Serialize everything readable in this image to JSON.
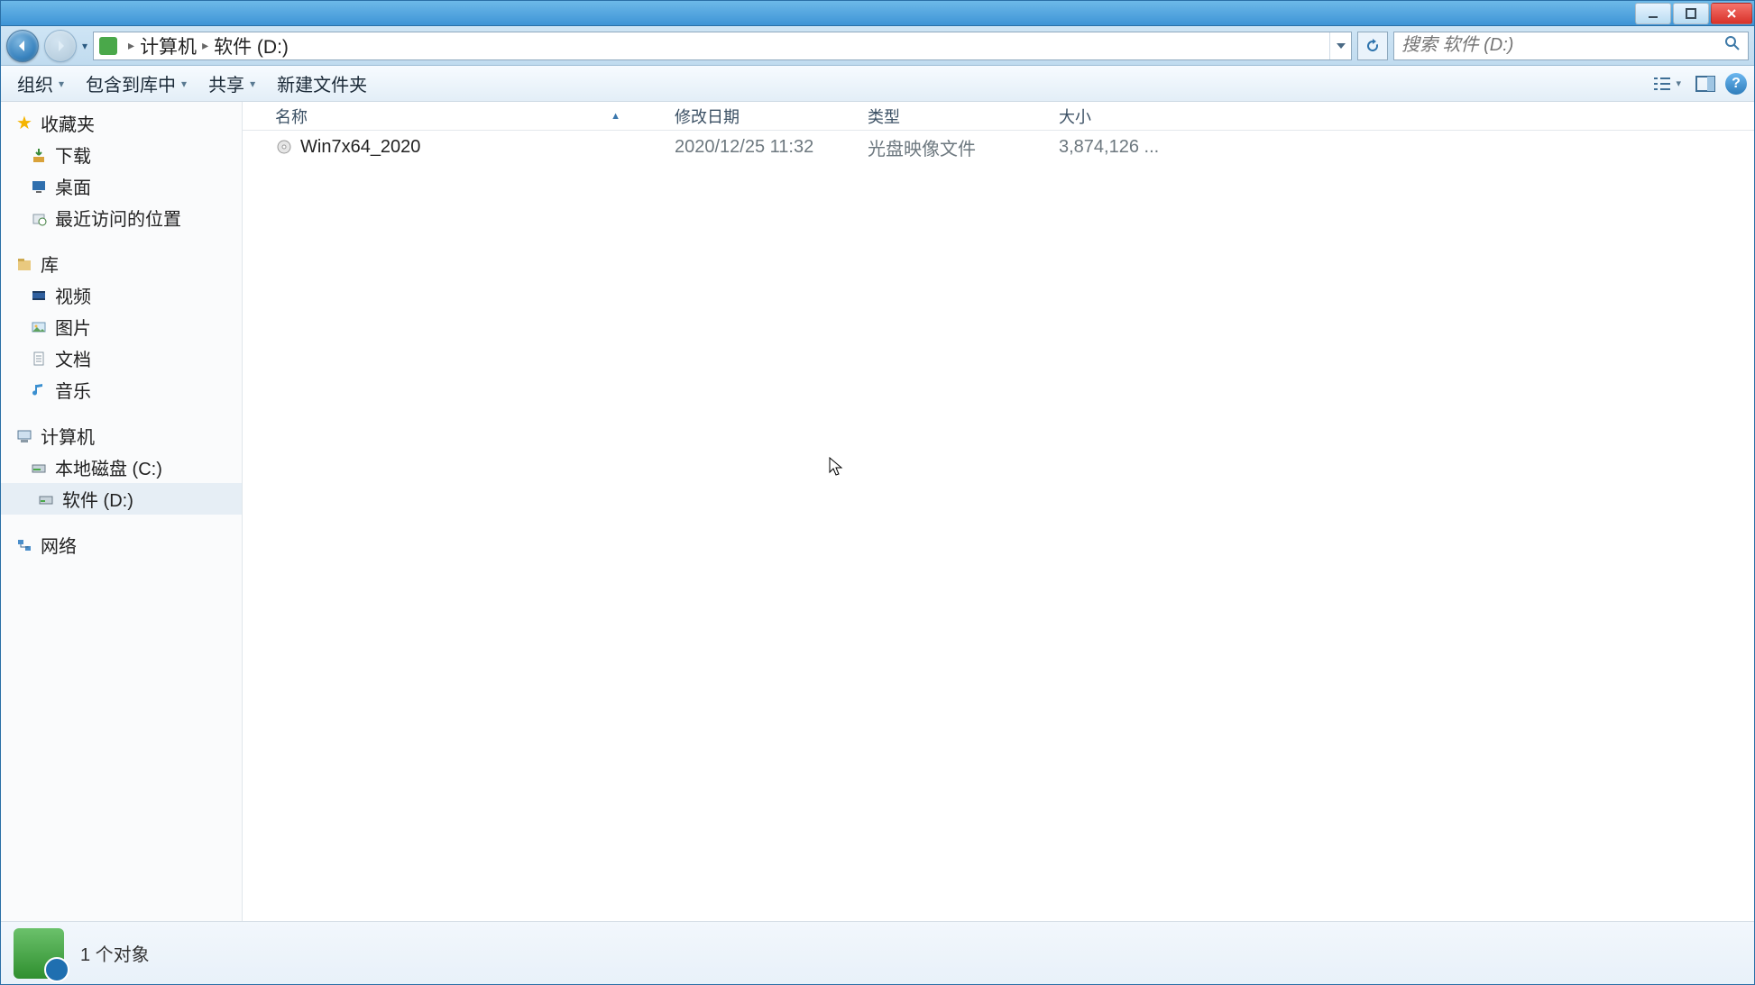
{
  "breadcrumbs": {
    "level1": "计算机",
    "level2": "软件 (D:)"
  },
  "search": {
    "placeholder": "搜索 软件 (D:)"
  },
  "toolbar": {
    "organize": "组织",
    "include_in_library": "包含到库中",
    "share": "共享",
    "new_folder": "新建文件夹"
  },
  "sidebar": {
    "favorites": {
      "label": "收藏夹",
      "items": [
        "下载",
        "桌面",
        "最近访问的位置"
      ]
    },
    "libraries": {
      "label": "库",
      "items": [
        "视频",
        "图片",
        "文档",
        "音乐"
      ]
    },
    "computer": {
      "label": "计算机",
      "items": [
        "本地磁盘 (C:)",
        "软件 (D:)"
      ]
    },
    "network": {
      "label": "网络"
    }
  },
  "columns": {
    "name": "名称",
    "modified": "修改日期",
    "type": "类型",
    "size": "大小"
  },
  "files": [
    {
      "name": "Win7x64_2020",
      "modified": "2020/12/25 11:32",
      "type": "光盘映像文件",
      "size": "3,874,126 ..."
    }
  ],
  "status": {
    "text": "1 个对象"
  }
}
